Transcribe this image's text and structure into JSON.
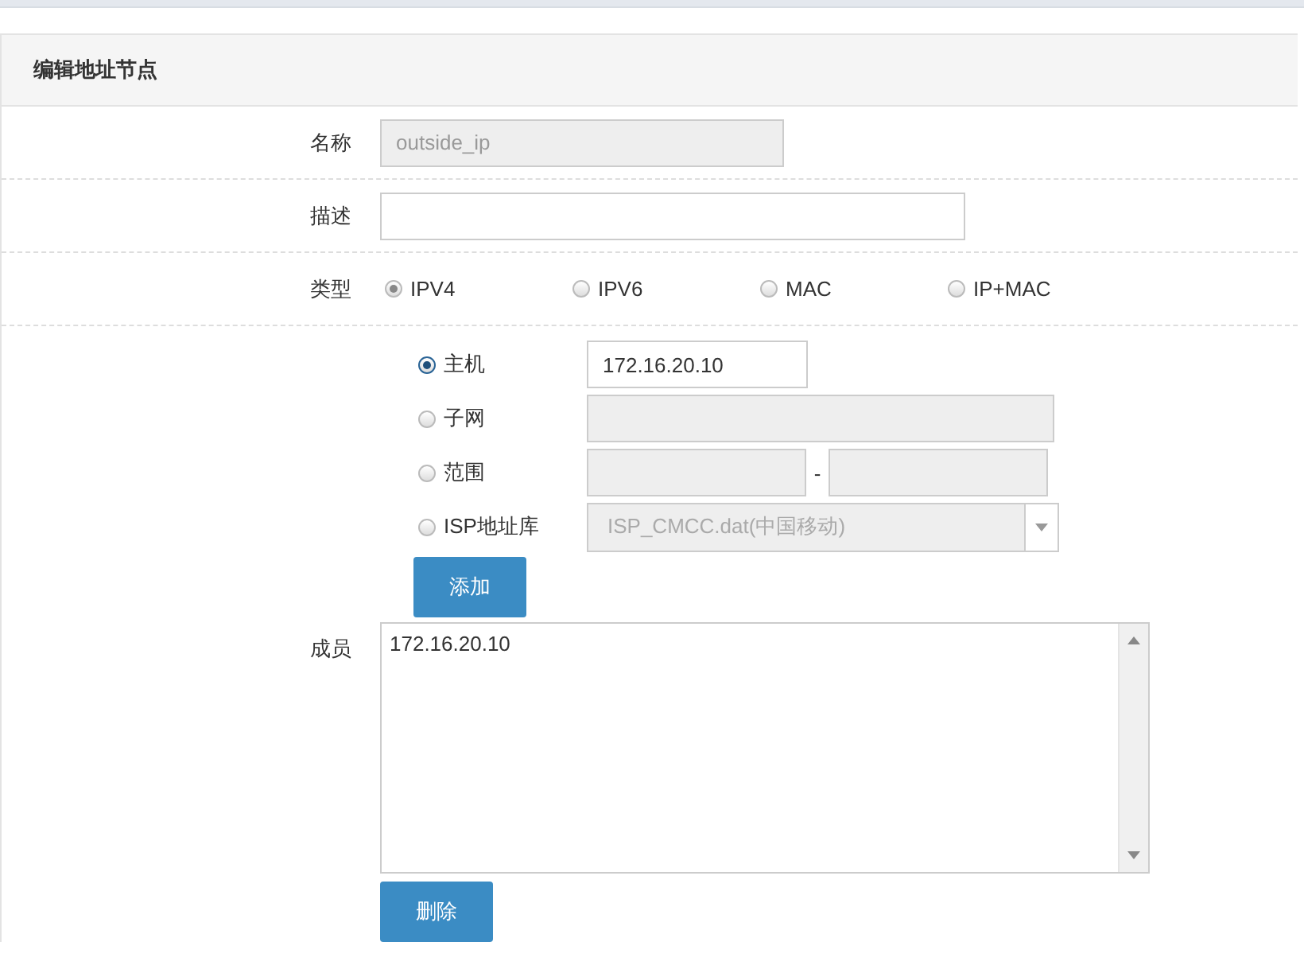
{
  "panel": {
    "title": "编辑地址节点"
  },
  "fields": [
    {
      "label": "名称",
      "value": "outside_ip",
      "disabled": true
    },
    {
      "label": "描述",
      "disabled": false
    }
  ],
  "type": {
    "label": "类型",
    "options": [
      {
        "label": "IPV4",
        "selected": true
      },
      {
        "label": "IPV6",
        "selected": false
      },
      {
        "label": "MAC",
        "selected": false
      },
      {
        "label": "IP+MAC",
        "selected": false
      }
    ]
  },
  "address": {
    "options": [
      {
        "kind": "single",
        "label": "主机",
        "selected": true,
        "value": "172.16.20.10",
        "disabled": false
      },
      {
        "kind": "single",
        "label": "子网",
        "selected": false,
        "disabled": true
      },
      {
        "kind": "range",
        "label": "范围",
        "selected": false,
        "disabled": true,
        "separator": "-"
      },
      {
        "kind": "select",
        "label": "ISP地址库",
        "selected": false,
        "disabled": true,
        "value": "ISP_CMCC.dat(中国移动)"
      }
    ]
  },
  "add_button": "添加",
  "members": {
    "label": "成员",
    "items": [
      "172.16.20.10"
    ]
  },
  "delete_button": "删除"
}
